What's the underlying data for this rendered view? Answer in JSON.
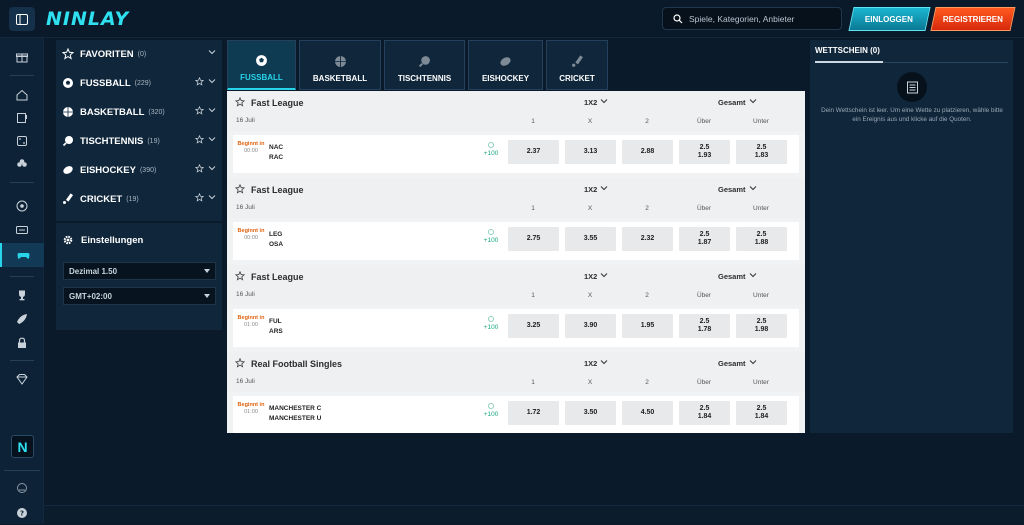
{
  "header": {
    "logo": "NINLAY",
    "search_placeholder": "Spiele, Kategorien, Anbieter",
    "login_label": "EINLOGGEN",
    "register_label": "REGISTRIEREN"
  },
  "rail": {
    "icons": [
      "gift-icon",
      "home-icon",
      "slot-icon",
      "dice-icon",
      "clover-icon",
      "soccer-icon",
      "tv-icon",
      "gamepad-icon",
      "trophy-icon",
      "rocket-icon",
      "lock-icon",
      "diamond-icon"
    ]
  },
  "sports": [
    {
      "label": "FAVORITEN",
      "count": "(0)",
      "icon": "star-icon"
    },
    {
      "label": "FUSSBALL",
      "count": "(229)",
      "icon": "soccer-ball-icon"
    },
    {
      "label": "BASKETBALL",
      "count": "(320)",
      "icon": "basketball-icon"
    },
    {
      "label": "TISCHTENNIS",
      "count": "(19)",
      "icon": "ping-pong-icon"
    },
    {
      "label": "EISHOCKEY",
      "count": "(390)",
      "icon": "hockey-puck-icon"
    },
    {
      "label": "CRICKET",
      "count": "(19)",
      "icon": "cricket-icon"
    }
  ],
  "settings": {
    "title": "Einstellungen",
    "odds_format": "Dezimal 1.50",
    "timezone": "GMT+02:00"
  },
  "tabs": [
    {
      "label": "FUSSBALL",
      "active": true
    },
    {
      "label": "BASKETBALL",
      "active": false
    },
    {
      "label": "TISCHTENNIS",
      "active": false
    },
    {
      "label": "EISHOCKEY",
      "active": false
    },
    {
      "label": "CRICKET",
      "active": false
    }
  ],
  "columns": {
    "h1": "1",
    "hx": "X",
    "h2": "2",
    "over": "Über",
    "under": "Unter"
  },
  "groups": [
    {
      "league": "Fast League",
      "market1": "1X2",
      "market2": "Gesamt",
      "date": "16 Juli",
      "match": {
        "begins": "Beginnt in",
        "time": "00:00",
        "home": "NAC",
        "away": "RAC",
        "more": "+100",
        "o1": "2.37",
        "ox": "3.13",
        "o2": "2.88",
        "over_line": "2.5",
        "over": "1.93",
        "under_line": "2.5",
        "under": "1.83"
      }
    },
    {
      "league": "Fast League",
      "market1": "1X2",
      "market2": "Gesamt",
      "date": "16 Juli",
      "match": {
        "begins": "Beginnt in",
        "time": "00:00",
        "home": "LEG",
        "away": "OSA",
        "more": "+100",
        "o1": "2.75",
        "ox": "3.55",
        "o2": "2.32",
        "over_line": "2.5",
        "over": "1.87",
        "under_line": "2.5",
        "under": "1.88"
      }
    },
    {
      "league": "Fast League",
      "market1": "1X2",
      "market2": "Gesamt",
      "date": "16 Juli",
      "match": {
        "begins": "Beginnt in",
        "time": "01:00",
        "home": "FUL",
        "away": "ARS",
        "more": "+100",
        "o1": "3.25",
        "ox": "3.90",
        "o2": "1.95",
        "over_line": "2.5",
        "over": "1.78",
        "under_line": "2.5",
        "under": "1.98"
      }
    },
    {
      "league": "Real Football Singles",
      "market1": "1X2",
      "market2": "Gesamt",
      "date": "16 Juli",
      "match": {
        "begins": "Beginnt in",
        "time": "01:00",
        "home": "MANCHESTER C",
        "away": "MANCHESTER U",
        "more": "+100",
        "o1": "1.72",
        "ox": "3.50",
        "o2": "4.50",
        "over_line": "2.5",
        "over": "1.84",
        "under_line": "2.5",
        "under": "1.84"
      }
    }
  ],
  "betslip": {
    "title": "WETTSCHEIN (0)",
    "empty_text": "Dein Wettschein ist leer. Um eine Wette zu platzieren, wähle bitte ein Ereignis aus und klicke auf die Quoten."
  }
}
